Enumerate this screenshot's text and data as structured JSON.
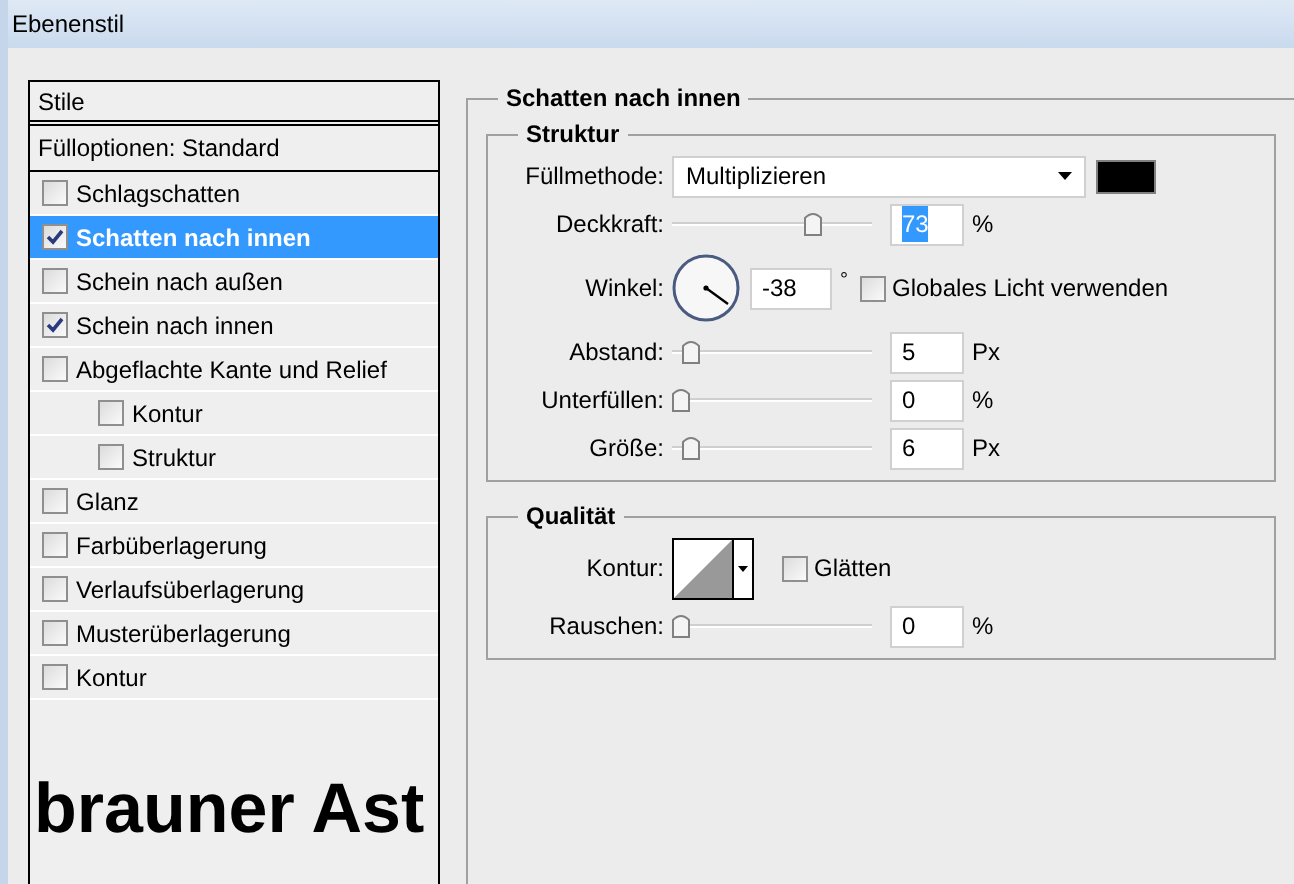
{
  "window": {
    "title": "Ebenenstil"
  },
  "styles": {
    "header": "Stile",
    "blend_options": "Fülloptionen: Standard",
    "items": [
      {
        "label": "Schlagschatten",
        "checked": false,
        "selected": false
      },
      {
        "label": "Schatten nach innen",
        "checked": true,
        "selected": true
      },
      {
        "label": "Schein nach außen",
        "checked": false,
        "selected": false
      },
      {
        "label": "Schein nach innen",
        "checked": true,
        "selected": false
      },
      {
        "label": "Abgeflachte Kante und Relief",
        "checked": false,
        "selected": false,
        "children": [
          {
            "label": "Kontur",
            "checked": false,
            "selected": false
          },
          {
            "label": "Struktur",
            "checked": false,
            "selected": false
          }
        ]
      },
      {
        "label": "Glanz",
        "checked": false,
        "selected": false
      },
      {
        "label": "Farbüberlagerung",
        "checked": false,
        "selected": false
      },
      {
        "label": "Verlaufsüberlagerung",
        "checked": false,
        "selected": false
      },
      {
        "label": "Musterüberlagerung",
        "checked": false,
        "selected": false
      },
      {
        "label": "Kontur",
        "checked": false,
        "selected": false
      }
    ],
    "caption": "brauner Ast"
  },
  "panel": {
    "title": "Schatten nach innen",
    "groups": [
      {
        "title": "Struktur",
        "rows": [
          {
            "kind": "dropdown",
            "label": "Füllmethode:",
            "value": "Multiplizieren"
          },
          {
            "kind": "slider",
            "label": "Deckkraft:",
            "level": 0.73,
            "value": "73",
            "unit": "%",
            "value_selected": true
          },
          {
            "kind": "angle",
            "label": "Winkel:",
            "value": "-38",
            "unit": "°",
            "checkbox": {
              "label": "Globales Licht verwenden",
              "checked": false
            }
          },
          {
            "kind": "slider",
            "label": "Abstand:",
            "level": 0.05,
            "value": "5",
            "unit": "Px",
            "value_selected": false
          },
          {
            "kind": "slider",
            "label": "Unterfüllen:",
            "level": 0,
            "value": "0",
            "unit": "%",
            "value_selected": false
          },
          {
            "kind": "slider",
            "label": "Größe:",
            "level": 0.06,
            "value": "6",
            "unit": "Px",
            "value_selected": false
          }
        ]
      },
      {
        "title": "Qualität",
        "rows": [
          {
            "kind": "contour",
            "label": "Kontur:",
            "checkbox": {
              "label": "Glätten",
              "checked": false
            }
          },
          {
            "kind": "slider",
            "label": "Rauschen:",
            "level": 0,
            "value": "0",
            "unit": "%",
            "value_selected": false
          }
        ]
      }
    ]
  }
}
